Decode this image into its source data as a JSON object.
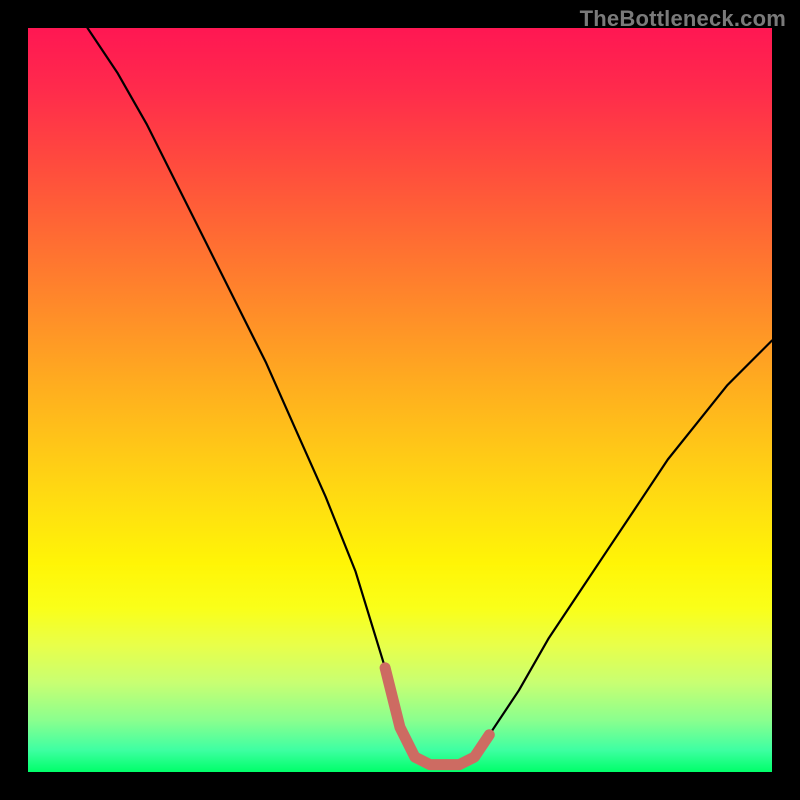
{
  "watermark": "TheBottleneck.com",
  "chart_data": {
    "type": "line",
    "title": "",
    "xlabel": "",
    "ylabel": "",
    "xlim": [
      0,
      100
    ],
    "ylim": [
      0,
      100
    ],
    "grid": false,
    "legend": false,
    "series": [
      {
        "name": "curve",
        "x": [
          8,
          12,
          16,
          20,
          24,
          28,
          32,
          36,
          40,
          44,
          48,
          50,
          52,
          54,
          56,
          58,
          60,
          62,
          66,
          70,
          74,
          78,
          82,
          86,
          90,
          94,
          98,
          100
        ],
        "values": [
          100,
          94,
          87,
          79,
          71,
          63,
          55,
          46,
          37,
          27,
          14,
          6,
          2,
          1,
          1,
          1,
          2,
          5,
          11,
          18,
          24,
          30,
          36,
          42,
          47,
          52,
          56,
          58
        ]
      }
    ],
    "annotations": [
      {
        "name": "valley-highlight",
        "x_range": [
          48,
          62
        ],
        "y": 1,
        "color": "#cd6b62"
      }
    ],
    "background_gradient": {
      "direction": "vertical",
      "stops": [
        {
          "pos": 0,
          "color": "#ff1753"
        },
        {
          "pos": 50,
          "color": "#ffcc16"
        },
        {
          "pos": 80,
          "color": "#faff19"
        },
        {
          "pos": 100,
          "color": "#00ff6a"
        }
      ]
    }
  }
}
